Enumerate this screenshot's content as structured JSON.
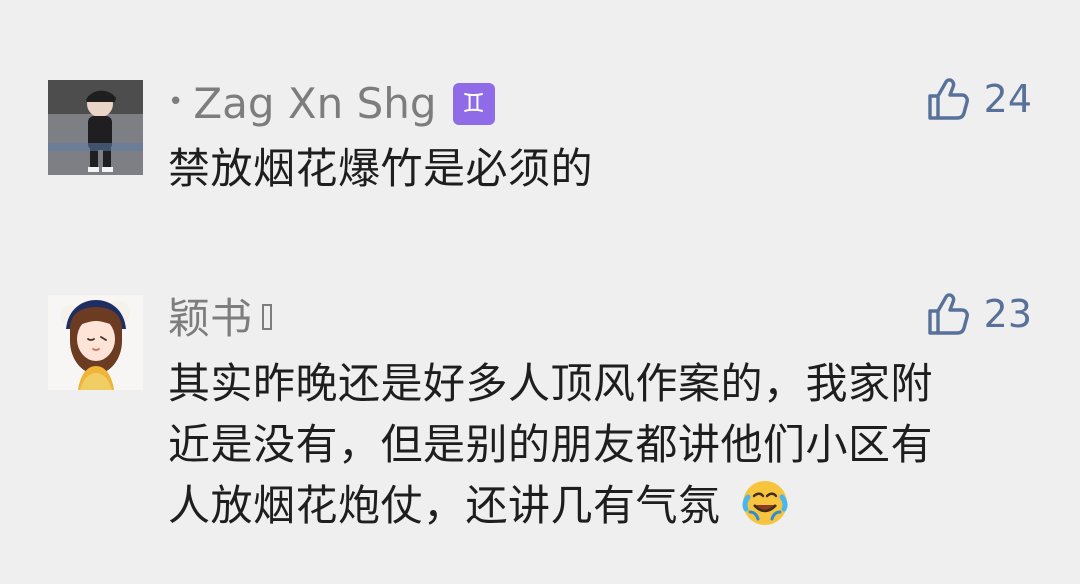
{
  "comments": [
    {
      "author": "Zag Xn Shg",
      "zodiac_badge": "♊",
      "like_count": "24",
      "text": "禁放烟花爆竹是必须的"
    },
    {
      "author": "颖书",
      "like_count": "23",
      "text_lines": [
        "其实昨晚还是好多人顶风作案的，我家附",
        "近是没有，但是别的朋友都讲他们小区有",
        "人放烟花炮仗，还讲几有气氛"
      ]
    }
  ],
  "colors": {
    "background": "#efefef",
    "author": "#7d7d7d",
    "like": "#58719a",
    "text": "#1e1e1e",
    "badge": "#8f6be8"
  },
  "icons": {
    "like": "thumbs-up-icon",
    "zodiac": "gemini-zodiac-badge",
    "emoji": "crying-laughing-emoji"
  }
}
